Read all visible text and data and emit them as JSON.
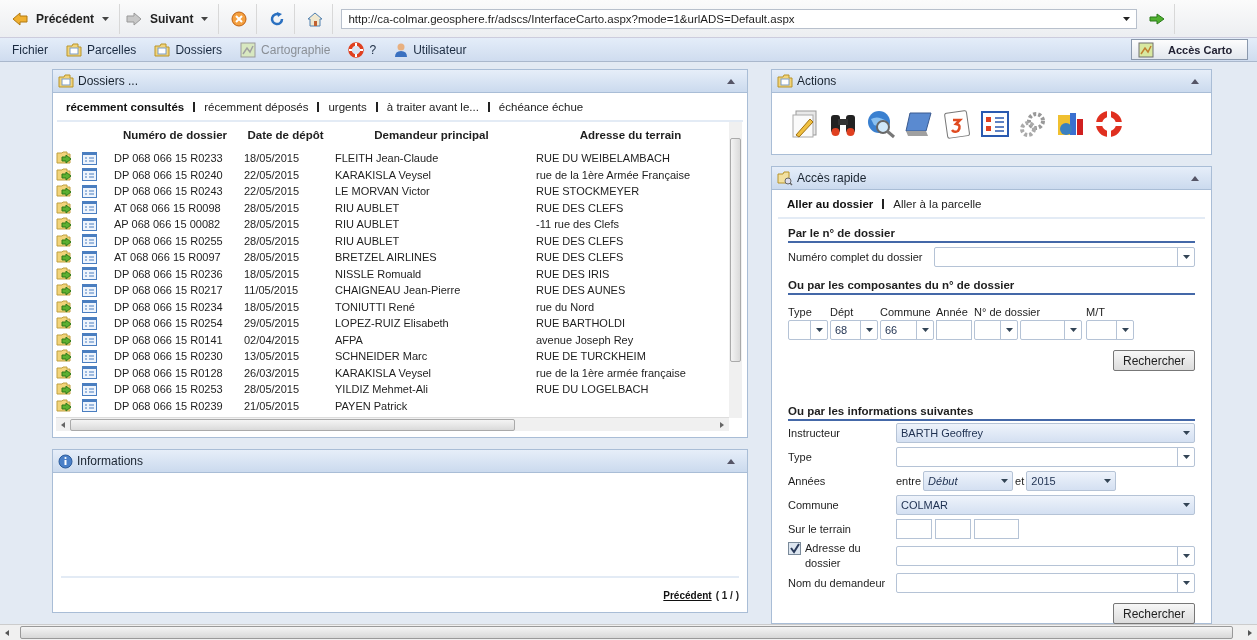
{
  "toolbar": {
    "back": "Précédent",
    "forward": "Suivant",
    "address": "http://ca-colmar.geosphere.fr/adscs/InterfaceCarto.aspx?mode=1&urlADS=Default.aspx"
  },
  "menu": [
    {
      "label": "Fichier",
      "disabled": false
    },
    {
      "label": "Parcelles",
      "disabled": false
    },
    {
      "label": "Dossiers",
      "disabled": false
    },
    {
      "label": "Cartographie",
      "disabled": true
    },
    {
      "label": "?",
      "disabled": false
    },
    {
      "label": "Utilisateur",
      "disabled": false
    }
  ],
  "carto_button": "Accès Carto",
  "dossiers": {
    "title": "Dossiers ...",
    "tabs": [
      {
        "label": "récemment consultés",
        "selected": true
      },
      {
        "label": "récemment déposés",
        "selected": false
      },
      {
        "label": "urgents",
        "selected": false
      },
      {
        "label": "à traiter avant le...",
        "selected": false
      },
      {
        "label": "échéance échue",
        "selected": false
      }
    ],
    "columns": [
      "Numéro de dossier",
      "Date de dépôt",
      "Demandeur principal",
      "Adresse du terrain"
    ],
    "rows": [
      [
        "DP 068 066 15 R0233",
        "18/05/2015",
        "FLEITH Jean-Claude",
        "RUE DU WEIBELAMBACH"
      ],
      [
        "DP 068 066 15 R0240",
        "22/05/2015",
        "KARAKISLA Veysel",
        "rue de la 1ère Armée Française"
      ],
      [
        "DP 068 066 15 R0243",
        "22/05/2015",
        "LE MORVAN Victor",
        "RUE STOCKMEYER"
      ],
      [
        "AT 068 066 15 R0098",
        "28/05/2015",
        "RIU AUBLET",
        "RUE DES CLEFS"
      ],
      [
        "AP 068 066 15 00082",
        "28/05/2015",
        "RIU AUBLET",
        "-11 rue des Clefs"
      ],
      [
        "DP 068 066 15 R0255",
        "28/05/2015",
        "RIU AUBLET",
        "RUE DES CLEFS"
      ],
      [
        "AT 068 066 15 R0097",
        "28/05/2015",
        "BRETZEL AIRLINES",
        "RUE DES CLEFS"
      ],
      [
        "DP 068 066 15 R0236",
        "18/05/2015",
        "NISSLE Romuald",
        "RUE DES IRIS"
      ],
      [
        "DP 068 066 15 R0217",
        "11/05/2015",
        "CHAIGNEAU Jean-Pierre",
        "RUE DES AUNES"
      ],
      [
        "DP 068 066 15 R0234",
        "18/05/2015",
        "TONIUTTI René",
        "rue du Nord"
      ],
      [
        "DP 068 066 15 R0254",
        "29/05/2015",
        "LOPEZ-RUIZ Elisabeth",
        "RUE BARTHOLDI"
      ],
      [
        "DP 068 066 15 R0141",
        "02/04/2015",
        "AFPA",
        "avenue Joseph Rey"
      ],
      [
        "DP 068 066 15 R0230",
        "13/05/2015",
        "SCHNEIDER Marc",
        "RUE DE TURCKHEIM"
      ],
      [
        "DP 068 066 15 R0128",
        "26/03/2015",
        "KARAKISLA Veysel",
        "rue de la 1ère armée française"
      ],
      [
        "DP 068 066 15 R0253",
        "28/05/2015",
        "YILDIZ Mehmet-Ali",
        "RUE DU LOGELBACH"
      ],
      [
        "DP 068 066 15 R0239",
        "21/05/2015",
        "PAYEN Patrick"
      ]
    ]
  },
  "informations": {
    "title": "Informations",
    "pager_link": "Précédent",
    "pager_text": "( 1 / )"
  },
  "actions": {
    "title": "Actions"
  },
  "acces_rapide": {
    "title": "Accès rapide",
    "tabs": [
      {
        "label": "Aller au dossier",
        "selected": true
      },
      {
        "label": "Aller à la parcelle",
        "selected": false
      }
    ],
    "section_1": "Par le n° de dossier",
    "full_number_label": "Numéro complet du dossier",
    "section_2": "Ou par les composantes du n° de dossier",
    "components": [
      {
        "label": "Type",
        "kind": "combo"
      },
      {
        "label": "Dépt",
        "kind": "combo",
        "value": "68"
      },
      {
        "label": "Commune",
        "kind": "combo",
        "value": "66"
      },
      {
        "label": "Année",
        "kind": "text"
      },
      {
        "label": "N° de dossier",
        "kind": "combo"
      },
      {
        "kind": "combo"
      },
      {
        "label": "M/T",
        "kind": "combo"
      }
    ],
    "search_button_1": "Rechercher",
    "section_3": "Ou par les informations suivantes",
    "fields": [
      {
        "kind": "combo",
        "label": "Instructeur",
        "value": "BARTH Geoffrey"
      },
      {
        "kind": "combo",
        "label": "Type"
      },
      {
        "kind": "years",
        "label": "Années",
        "between": "entre",
        "from": "Début",
        "and": "et",
        "to": "2015"
      },
      {
        "kind": "combo",
        "label": "Commune",
        "value": "COLMAR"
      },
      {
        "kind": "boxes",
        "label": "Sur le terrain"
      },
      {
        "kind": "check-combo",
        "label": "Adresse du dossier",
        "checked": true
      },
      {
        "kind": "combo",
        "label": "Nom du demandeur"
      }
    ],
    "search_button_2": "Rechercher"
  }
}
